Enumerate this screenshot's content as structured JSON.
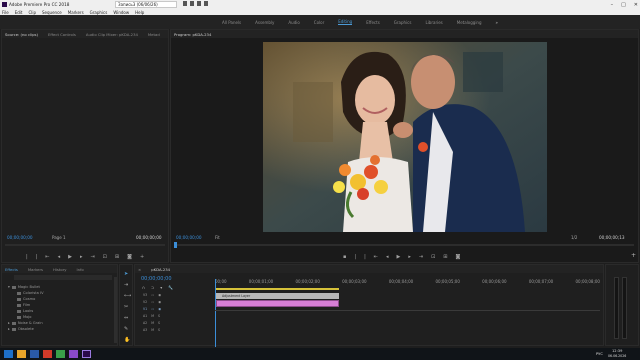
{
  "titlebar": {
    "app_title": "Adobe Premiere Pro CC 2018",
    "project_name": "Запись3 (06/06/26)",
    "window_buttons": [
      "–",
      "□",
      "✕"
    ]
  },
  "menu": [
    "File",
    "Edit",
    "Clip",
    "Sequence",
    "Markers",
    "Graphics",
    "Window",
    "Help"
  ],
  "workspaces": {
    "items": [
      "All Panels",
      "Assembly",
      "Audio",
      "Color",
      "Editing",
      "Effects",
      "Graphics",
      "Libraries",
      "Metalogging"
    ],
    "active": "Editing",
    "more": "»"
  },
  "source_panel": {
    "tabs": [
      "Source: (no clips)",
      "Effect Controls",
      "Audio Clip Mixer: pKDA-234",
      "Metad"
    ],
    "timecode_left": "00;00;00;00",
    "page": "Page 1",
    "timecode_right": "00;00;00;00"
  },
  "program_panel": {
    "tab": "Program: pKDA-234",
    "timecode_left": "00;00;00;00",
    "fit": "Fit",
    "zoom": "1/2",
    "timecode_right": "00;00;00;13"
  },
  "effects_panel": {
    "tabs": [
      "Effects",
      "Markers",
      "History",
      "Info"
    ],
    "items": [
      {
        "label": "Magic Bullet",
        "indent": 0,
        "open": true
      },
      {
        "label": "Colorista IV",
        "indent": 1
      },
      {
        "label": "Cosmo",
        "indent": 1
      },
      {
        "label": "Film",
        "indent": 1
      },
      {
        "label": "Looks",
        "indent": 1
      },
      {
        "label": "Mojo",
        "indent": 1
      },
      {
        "label": "Noise & Grain",
        "indent": 0
      },
      {
        "label": "Obsolete",
        "indent": 0
      }
    ]
  },
  "timeline": {
    "tab": "pKDA-234",
    "timecode": "00;00;00;00",
    "ruler": [
      "00;00",
      "00;00;01;00",
      "00;00;02;00",
      "00;00;03;00",
      "00;00;04;00",
      "00;00;05;00",
      "00;00;06;00",
      "00;00;07;00",
      "00;00;08;00"
    ],
    "tracks": [
      "V3",
      "V2",
      "V1",
      "A1",
      "A2",
      "A3"
    ],
    "clip_label": "Adjustment Layer"
  },
  "taskbar": {
    "lang": "РУС",
    "time": "12:39",
    "date": "06.06.2026"
  }
}
